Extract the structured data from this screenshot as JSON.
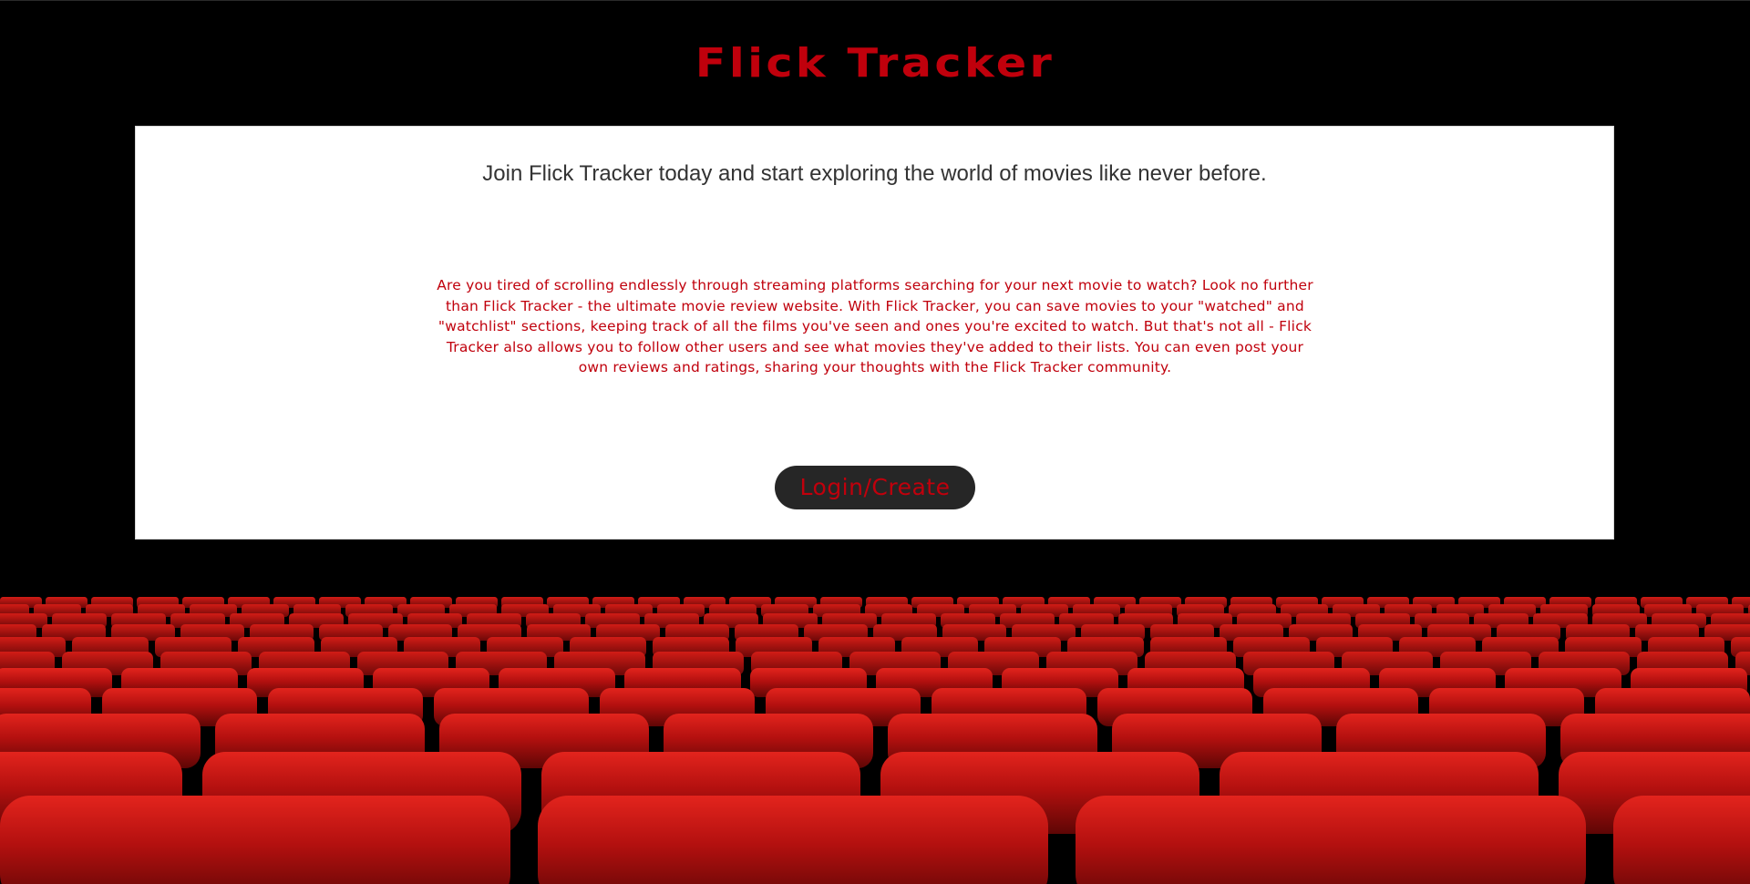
{
  "site": {
    "title": "Flick Tracker"
  },
  "hero": {
    "tagline": "Join Flick Tracker today and start exploring the world of movies like never before.",
    "description": "Are you tired of scrolling endlessly through streaming platforms searching for your next movie to watch? Look no further than Flick Tracker - the ultimate movie review website. With Flick Tracker, you can save movies to your \"watched\" and \"watchlist\" sections, keeping track of all the films you've seen and ones you're excited to watch. But that's not all - Flick Tracker also allows you to follow other users and see what movies they've added to their lists. You can even post your own reviews and ratings, sharing your thoughts with the Flick Tracker community.",
    "login_button_label": "Login/Create"
  },
  "colors": {
    "brand_red": "#c0000c",
    "background": "#000000",
    "panel": "#ffffff",
    "button_bg": "#262626",
    "seat_red": "#b3100f"
  }
}
